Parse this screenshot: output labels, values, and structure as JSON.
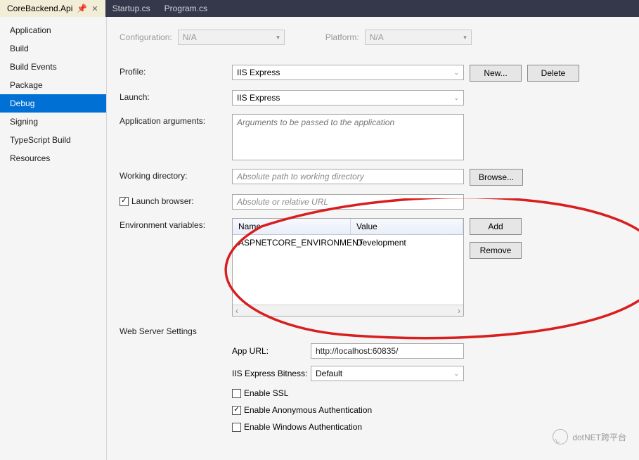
{
  "tabs": [
    {
      "label": "CoreBackend.Api",
      "active": true,
      "pinned": true
    },
    {
      "label": "Startup.cs",
      "active": false
    },
    {
      "label": "Program.cs",
      "active": false
    }
  ],
  "sidebar": {
    "items": [
      {
        "label": "Application"
      },
      {
        "label": "Build"
      },
      {
        "label": "Build Events"
      },
      {
        "label": "Package"
      },
      {
        "label": "Debug",
        "active": true
      },
      {
        "label": "Signing"
      },
      {
        "label": "TypeScript Build"
      },
      {
        "label": "Resources"
      }
    ]
  },
  "topbar": {
    "configuration_label": "Configuration:",
    "configuration_value": "N/A",
    "platform_label": "Platform:",
    "platform_value": "N/A"
  },
  "form": {
    "profile_label": "Profile:",
    "profile_value": "IIS Express",
    "new_btn": "New...",
    "delete_btn": "Delete",
    "launch_label": "Launch:",
    "launch_value": "IIS Express",
    "args_label": "Application arguments:",
    "args_placeholder": "Arguments to be passed to the application",
    "workdir_label": "Working directory:",
    "workdir_placeholder": "Absolute path to working directory",
    "browse_btn": "Browse...",
    "launch_browser_label": "Launch browser:",
    "launch_browser_checked": true,
    "launch_browser_placeholder": "Absolute or relative URL",
    "env_label": "Environment variables:",
    "env_headers": {
      "name": "Name",
      "value": "Value"
    },
    "env_rows": [
      {
        "name": "ASPNETCORE_ENVIRONMENT",
        "value": "Development"
      }
    ],
    "add_btn": "Add",
    "remove_btn": "Remove"
  },
  "web": {
    "section_title": "Web Server Settings",
    "appurl_label": "App URL:",
    "appurl_value": "http://localhost:60835/",
    "bitness_label": "IIS Express Bitness:",
    "bitness_value": "Default",
    "enable_ssl_label": "Enable SSL",
    "enable_ssl_checked": false,
    "enable_anon_label": "Enable Anonymous Authentication",
    "enable_anon_checked": true,
    "enable_win_label": "Enable Windows Authentication",
    "enable_win_checked": false
  },
  "watermark": "dotNET跨平台"
}
